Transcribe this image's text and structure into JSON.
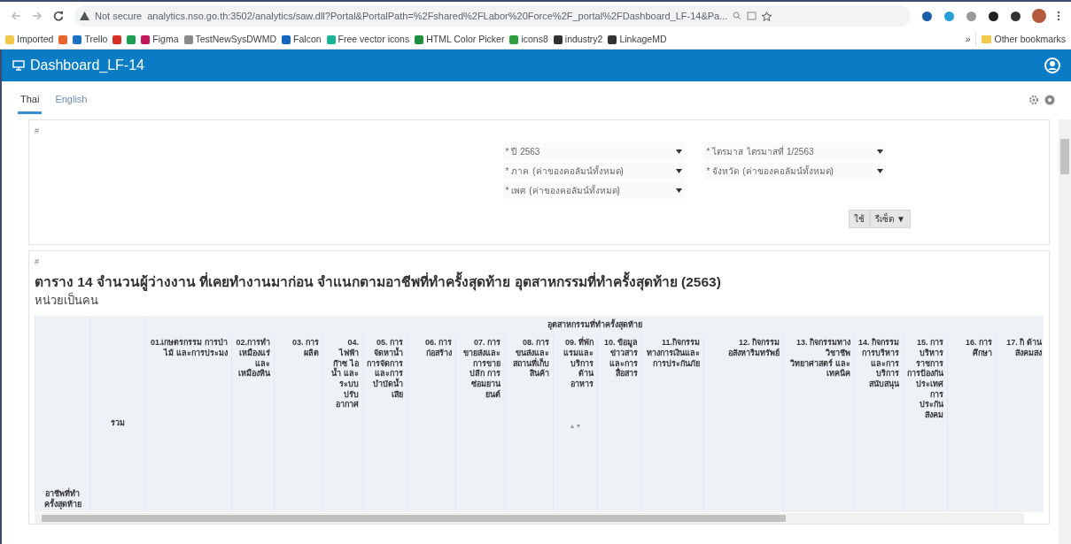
{
  "browser": {
    "security": "Not secure",
    "url": "analytics.nso.go.th:3502/analytics/saw.dll?Portal&PortalPath=%2Fshared%2FLabor%20Force%2F_portal%2FDashboard_LF-14&Pa...",
    "bookmarks": [
      {
        "label": "Imported",
        "color": "#f2c94c"
      },
      {
        "color": "#e8662e"
      },
      {
        "label": "Trello",
        "color": "#1d72c4"
      },
      {
        "color": "#d93025"
      },
      {
        "color": "#1e9e55"
      },
      {
        "label": "Figma",
        "color": "#c2185b"
      },
      {
        "label": "TestNewSysDWMD",
        "color": "#8a8a8a"
      },
      {
        "label": "Falcon",
        "color": "#1565c0"
      },
      {
        "label": "Free vector icons",
        "color": "#1ab394"
      },
      {
        "label": "HTML Color Picker",
        "color": "#1e8e3e"
      },
      {
        "label": "icons8",
        "color": "#2e9e3e"
      },
      {
        "label": "industry2",
        "color": "#333333"
      },
      {
        "label": "LinkageMD",
        "color": "#333333"
      }
    ],
    "more": "»",
    "other": "Other bookmarks"
  },
  "app": {
    "title": "Dashboard_LF-14"
  },
  "tabs": [
    {
      "label": "Thai",
      "selected": true
    },
    {
      "label": "English",
      "selected": false
    }
  ],
  "prompts": {
    "anchor": "#",
    "filters": [
      {
        "label": "* ปี",
        "value": "2563"
      },
      {
        "label": "* ไตรมาส",
        "value": "ไตรมาสที่ 1/2563"
      },
      {
        "label": "* ภาค",
        "value": "(ค่าของคอลัมน์ทั้งหมด)"
      },
      {
        "label": "* จังหวัด",
        "value": "(ค่าของคอลัมน์ทั้งหมด)"
      },
      {
        "label": "* เพศ",
        "value": "(ค่าของคอลัมน์ทั้งหมด)"
      }
    ],
    "buttons": [
      "ใช้",
      "รีเซ็ต ▼"
    ]
  },
  "report": {
    "anchor": "#",
    "title": "ตาราง 14 จำนวนผู้ว่างงาน ที่เคยทำงานมาก่อน จำแนกตามอาชีพที่ทำครั้งสุดท้าย อุตสาหกรรมที่ทำครั้งสุดท้าย (2563)",
    "subtitle": "หน่วยเป็นคน",
    "row_header": "อาชีพที่ทำครั้งสุดท้าย",
    "total_header": "รวม",
    "group_header": "อุตสาหกรรมที่ทำครั้งสุดท้าย",
    "columns": [
      {
        "label": "01.เกษตรกรรม การป่าไม้ และการประมง"
      },
      {
        "label": "02.การทำเหมืองแร่และเหมืองหิน"
      },
      {
        "label": "03. การผลิต"
      },
      {
        "label": "04. ไฟฟ้า ก๊าซ ไอน้ำ และระบบปรับอากาศ"
      },
      {
        "label": "05. การจัดหาน้ำ การจัดการ และการบำบัดน้ำเสีย"
      },
      {
        "label": "06. การก่อสร้าง"
      },
      {
        "label": "07. การขายส่งและการขายปลีก การซ่อมยานยนต์"
      },
      {
        "label": "08. การขนส่งและสถานที่เก็บสินค้า"
      },
      {
        "label": "09. ที่พักแรมและบริการด้านอาหาร",
        "sort": "▲▼"
      },
      {
        "label": "10. ข้อมูลข่าวสารและการสื่อสาร"
      },
      {
        "label": "11.กิจกรรมทางการเงินและการประกันภัย"
      },
      {
        "label": "12. กิจกรรมอสังหาริมทรัพย์"
      },
      {
        "label": "13. กิจกรรมทางวิชาชีพ วิทยาศาสตร์ และเทคนิค"
      },
      {
        "label": "14. กิจกรรมการบริหารและการบริการสนับสนุน"
      },
      {
        "label": "15. การบริหารราชการ การป้องกันประเทศ การประกันสังคม"
      },
      {
        "label": "16. การศึกษา"
      },
      {
        "label": "17. กิ ด้าน สังคมสง"
      }
    ]
  }
}
